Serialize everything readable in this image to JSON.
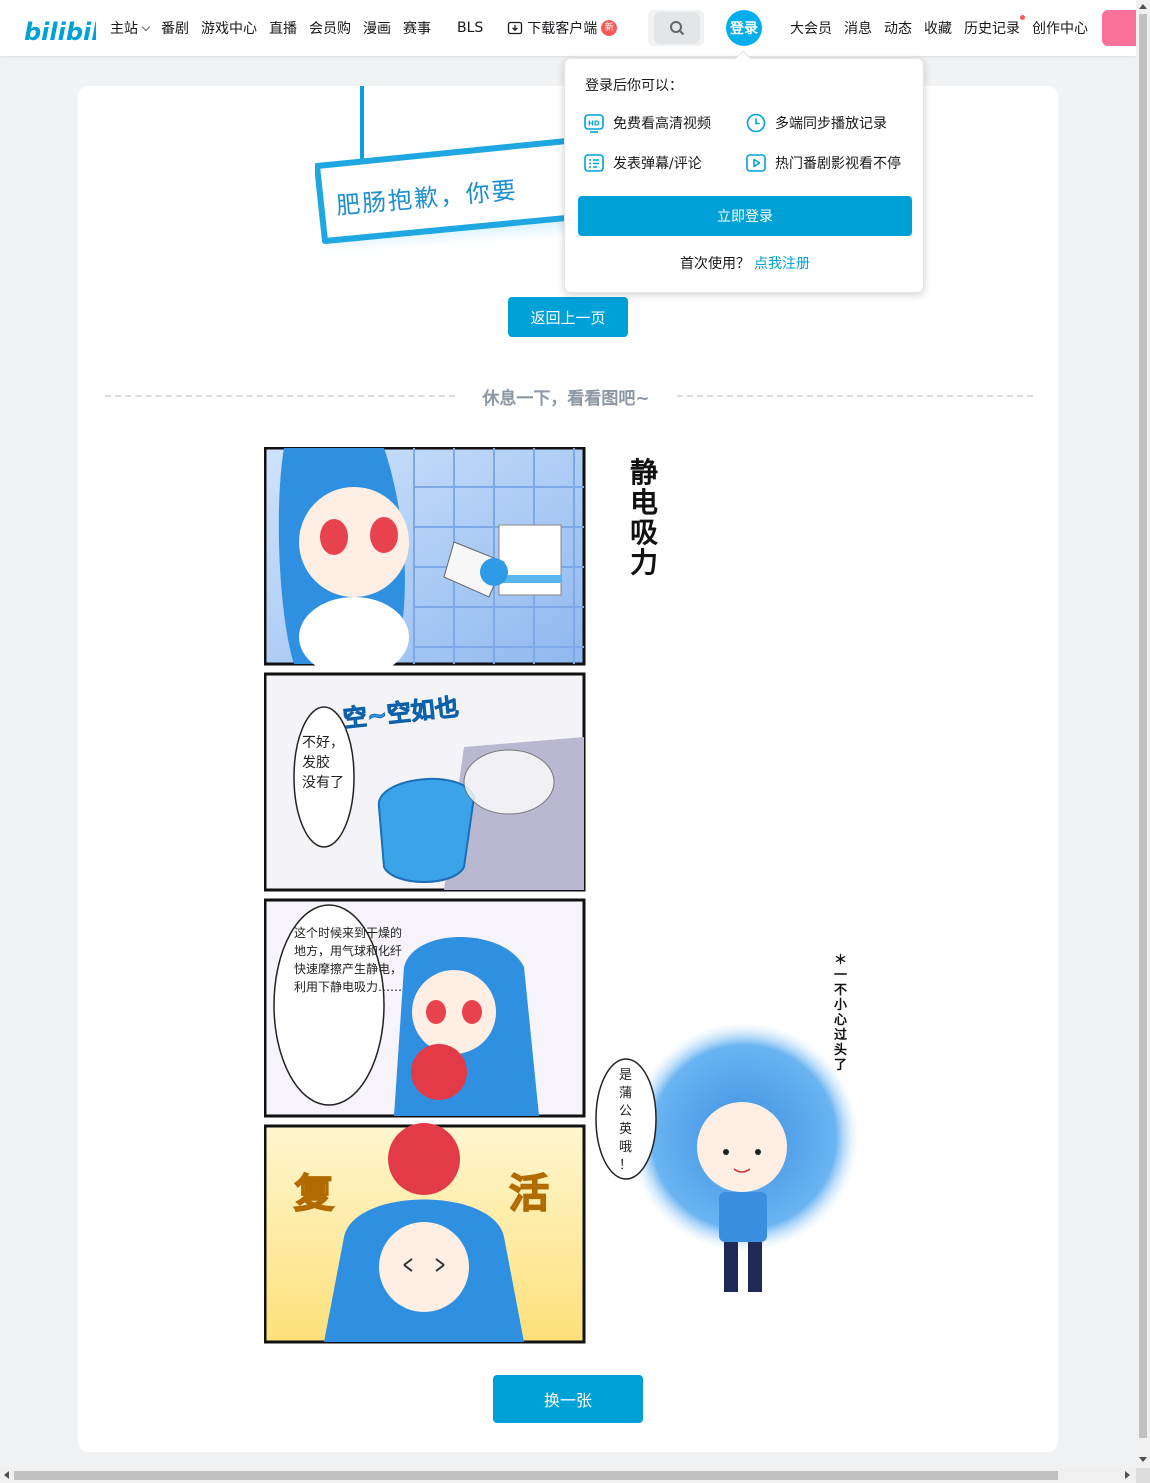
{
  "header": {
    "logo_text": "bilibili",
    "nav_left": [
      "主站",
      "番剧",
      "游戏中心",
      "直播",
      "会员购",
      "漫画",
      "赛事"
    ],
    "bls": "BLS",
    "download": "下载客户端",
    "new_badge": "新",
    "login": "登录",
    "nav_right": [
      "大会员",
      "消息",
      "动态",
      "收藏",
      "历史记录",
      "创作中心"
    ]
  },
  "error_sign": {
    "text": "肥肠抱歉，你要"
  },
  "main": {
    "back_button": "返回上一页",
    "divider_text": "休息一下，看看图吧~",
    "swap_button": "换一张"
  },
  "comic": {
    "side_title": "静电吸力",
    "panel2_bubble": "不好，发胶没有了",
    "panel2_sfx": "空~空如也",
    "panel3_bubble": "这个时候来到干燥的地方，用气球和化纤快速摩擦产生静电，利用下静电吸力……",
    "panel4_sfx_left": "复",
    "panel4_sfx_right": "活",
    "side_note": "＊一不小心过头了",
    "side_bubble": "是蒲公英哦！"
  },
  "login_popover": {
    "title": "登录后你可以：",
    "perks": [
      "免费看高清视频",
      "多端同步播放记录",
      "发表弹幕/评论",
      "热门番剧影视看不停"
    ],
    "login_button": "立即登录",
    "register_prompt": "首次使用？",
    "register_link": "点我注册"
  },
  "colors": {
    "brand_blue": "#00a1d6",
    "pink": "#fb7299",
    "badge_red": "#fa5a57"
  }
}
